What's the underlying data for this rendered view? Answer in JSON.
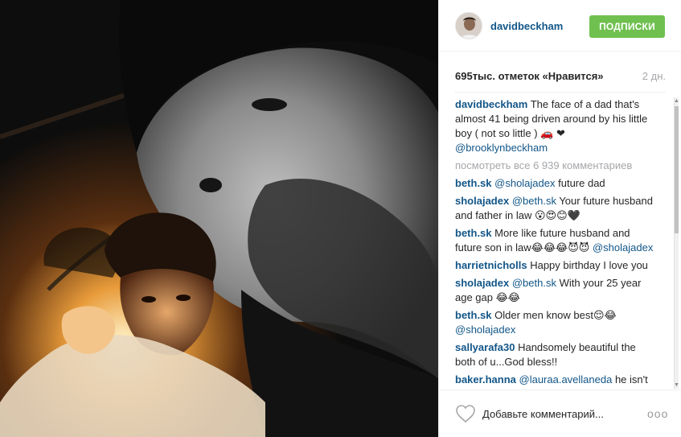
{
  "header": {
    "username": "davidbeckham",
    "follow_label": "ПОДПИСКИ"
  },
  "stats": {
    "likes": "695тыс. отметок «Нравится»",
    "time": "2 дн."
  },
  "caption": {
    "user": "davidbeckham",
    "text": "The face of a dad that's almost 41 being driven around by his little boy ( not so little ) 🚗 ❤",
    "mention": "@brooklynbeckham"
  },
  "view_all": "посмотреть все 6 939 комментариев",
  "comments": [
    {
      "user": "beth.sk",
      "mention": "@sholajadex",
      "text": " future dad",
      "trail_mention": ""
    },
    {
      "user": "sholajadex",
      "mention": "@beth.sk",
      "text": " Your future husband and father in law 😮😍😊🖤",
      "trail_mention": ""
    },
    {
      "user": "beth.sk",
      "mention": "",
      "text": "More like future husband and future son in law😂😂😂😈😈",
      "trail_mention": "@sholajadex"
    },
    {
      "user": "harrietnicholls",
      "mention": "",
      "text": "Happy birthday I love you",
      "trail_mention": ""
    },
    {
      "user": "sholajadex",
      "mention": "@beth.sk",
      "text": " With your 25 year age gap 😂😂",
      "trail_mention": ""
    },
    {
      "user": "beth.sk",
      "mention": "",
      "text": "Older men know best😌😂",
      "trail_mention": "@sholajadex"
    },
    {
      "user": "sallyarafa30",
      "mention": "",
      "text": "Handsomely beautiful the both of u...God bless!!",
      "trail_mention": ""
    },
    {
      "user": "baker.hanna",
      "mention": "@lauraa.avellaneda",
      "text": " he isn't",
      "trail_mention": ""
    }
  ],
  "footer": {
    "comment_placeholder": "Добавьте комментарий...",
    "more_label": "ooo"
  },
  "icons": {
    "like": "heart-icon",
    "more": "more-options-icon",
    "avatar": "avatar"
  },
  "colors": {
    "link": "#125688",
    "follow": "#70c050",
    "muted": "#a5a7aa"
  }
}
